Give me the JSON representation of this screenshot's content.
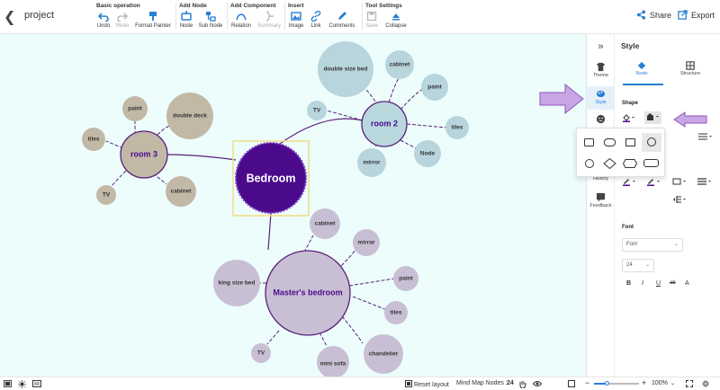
{
  "app": {
    "project_title": "project"
  },
  "toolbar": {
    "groups": [
      {
        "title": "Basic operation"
      },
      {
        "title": "Add Node"
      },
      {
        "title": "Add Component"
      },
      {
        "title": "Insert"
      },
      {
        "title": "Tool Settings"
      }
    ],
    "tools": {
      "undo": "Undo",
      "redo": "Redo",
      "format_painter": "Format Painter",
      "node": "Node",
      "sub_node": "Sub Node",
      "relation": "Relation",
      "summary": "Summary",
      "image": "Image",
      "link": "Link",
      "comments": "Comments",
      "save": "Save",
      "collapse": "Collapse"
    },
    "share_label": "Share",
    "export_label": "Export"
  },
  "mindmap": {
    "center": "Bedroom",
    "room2": {
      "label": "room 2",
      "children": [
        "double size bed",
        "cabinet",
        "paint",
        "tiles",
        "Node",
        "mirror",
        "TV"
      ]
    },
    "room3": {
      "label": "room 3",
      "children": [
        "paint",
        "double deck",
        "tiles",
        "cabinet",
        "TV"
      ]
    },
    "master": {
      "label": "Master's bedroom",
      "children": [
        "cabinet",
        "mirror",
        "paint",
        "tiles",
        "chandelier",
        "mini sofa",
        "TV",
        "king size bed"
      ]
    },
    "colors": {
      "center_fill": "#4b0a8c",
      "center_selection": "#f2e6a6",
      "room_fill": "#b8d8de",
      "room3_fill": "#c2b8a6",
      "master_fill": "#c8bfd4",
      "line": "#5a1f78",
      "canvas_bg": "#ecfdfc"
    }
  },
  "sidebar_icons": [
    {
      "name": "collapse-panel-icon",
      "label": ""
    },
    {
      "name": "theme-icon",
      "label": "Theme"
    },
    {
      "name": "style-icon",
      "label": "Style"
    },
    {
      "name": "emoji-icon",
      "label": ""
    },
    {
      "name": "history-icon",
      "label": "History"
    },
    {
      "name": "feedback-icon",
      "label": "Feedback"
    }
  ],
  "style_panel": {
    "title": "Style",
    "tabs": [
      "Node",
      "Structure"
    ],
    "shape_label": "Shape",
    "font_label": "Font",
    "font_family": "Font",
    "font_size": "24",
    "text_buttons": [
      "B",
      "I",
      "U",
      "ab",
      "A"
    ]
  },
  "bottom": {
    "reset_layout": "Reset layout",
    "node_count_label": "Mind Map Nodes :",
    "node_count": "24",
    "zoom": "100%"
  }
}
